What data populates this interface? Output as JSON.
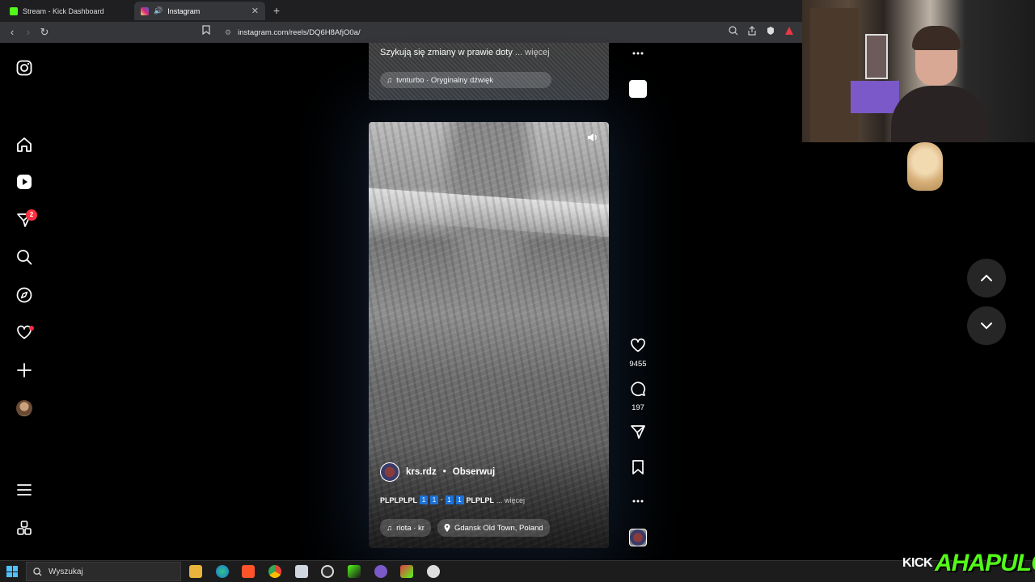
{
  "browser": {
    "tabs": [
      {
        "label": "Stream - Kick Dashboard",
        "active": false,
        "favicon_color": "#53fc18"
      },
      {
        "label": "Instagram",
        "active": true,
        "favicon_color": "#e1306c"
      }
    ],
    "url": "instagram.com/reels/DQ6H8AfjO0a/"
  },
  "sidebar": {
    "notifications_badge": "2"
  },
  "previous_reel": {
    "caption": "Szykują się zmiany w prawie doty",
    "more": "... więcej",
    "audio": "tvnturbo · Oryginalny dźwięk"
  },
  "current_reel": {
    "author": "krs.rdz",
    "separator": "•",
    "follow_label": "Obserwuj",
    "caption_prefix": "PLPLPLPL",
    "caption_digits": [
      "1",
      "1",
      "1",
      "1"
    ],
    "caption_suffix": "PLPLPL",
    "caption_more": "... więcej",
    "audio": "riota · kr",
    "location": "Gdansk Old Town, Poland"
  },
  "actions": {
    "likes": "9455",
    "comments": "197"
  },
  "taskbar": {
    "search_placeholder": "Wyszukaj"
  },
  "overlay": {
    "kick_label": "KICK",
    "channel_label": "AHAPULCO"
  },
  "colors": {
    "badge": "#ff3040",
    "kick_green": "#53fc18",
    "windows_blue": "#4cc2ff"
  }
}
